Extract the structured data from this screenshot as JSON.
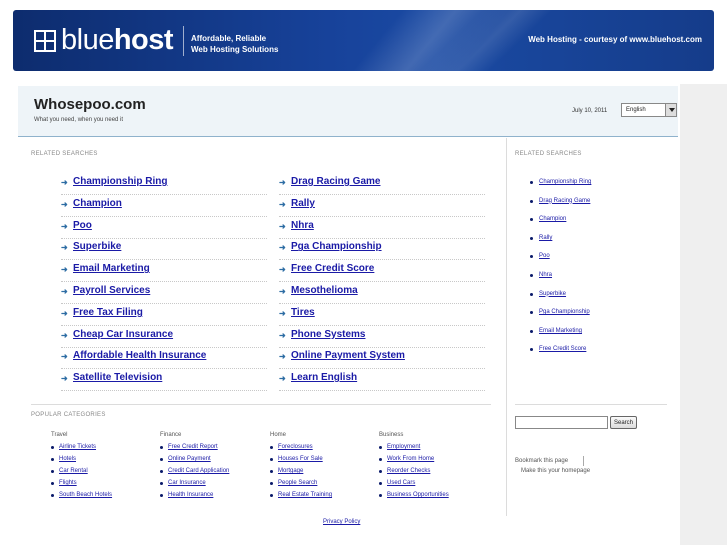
{
  "banner": {
    "logo_light": "blue",
    "logo_bold": "host",
    "tagline_line1": "Affordable, Reliable",
    "tagline_line2": "Web Hosting Solutions",
    "courtesy": "Web Hosting - courtesy of www.bluehost.com"
  },
  "header": {
    "title": "Whosepoo.com",
    "subtitle": "What you need, when you need it",
    "date": "July 10, 2011",
    "language": "English"
  },
  "related": {
    "label": "RELATED SEARCHES",
    "left": [
      "Championship Ring",
      "Champion",
      "Poo",
      "Superbike",
      "Email Marketing",
      "Payroll Services",
      "Free Tax Filing",
      "Cheap Car Insurance",
      "Affordable Health Insurance",
      "Satellite Television"
    ],
    "right": [
      "Drag Racing Game",
      "Rally",
      "Nhra",
      "Pga Championship",
      "Free Credit Score",
      "Mesothelioma",
      "Tires",
      "Phone Systems",
      "Online Payment System",
      "Learn English"
    ]
  },
  "sidebar": {
    "label": "RELATED SEARCHES",
    "links": [
      "Championship Ring",
      "Drag Racing Game",
      "Champion",
      "Rally",
      "Poo",
      "Nhra",
      "Superbike",
      "Pga Championship",
      "Email Marketing",
      "Free Credit Score"
    ],
    "search_button": "Search",
    "bookmark": "Bookmark this page",
    "homepage": "Make this your homepage"
  },
  "popular": {
    "label": "POPULAR CATEGORIES",
    "categories": [
      {
        "name": "Travel",
        "items": [
          "Airline Tickets",
          "Hotels",
          "Car Rental",
          "Flights",
          "South Beach Hotels"
        ]
      },
      {
        "name": "Finance",
        "items": [
          "Free Credit Report",
          "Online Payment",
          "Credit Card Application",
          "Car Insurance",
          "Health Insurance"
        ]
      },
      {
        "name": "Home",
        "items": [
          "Foreclosures",
          "Houses For Sale",
          "Mortgage",
          "People Search",
          "Real Estate Training"
        ]
      },
      {
        "name": "Business",
        "items": [
          "Employment",
          "Work From Home",
          "Reorder Checks",
          "Used Cars",
          "Business Opportunities"
        ]
      }
    ]
  },
  "footer": {
    "privacy": "Privacy Policy"
  }
}
